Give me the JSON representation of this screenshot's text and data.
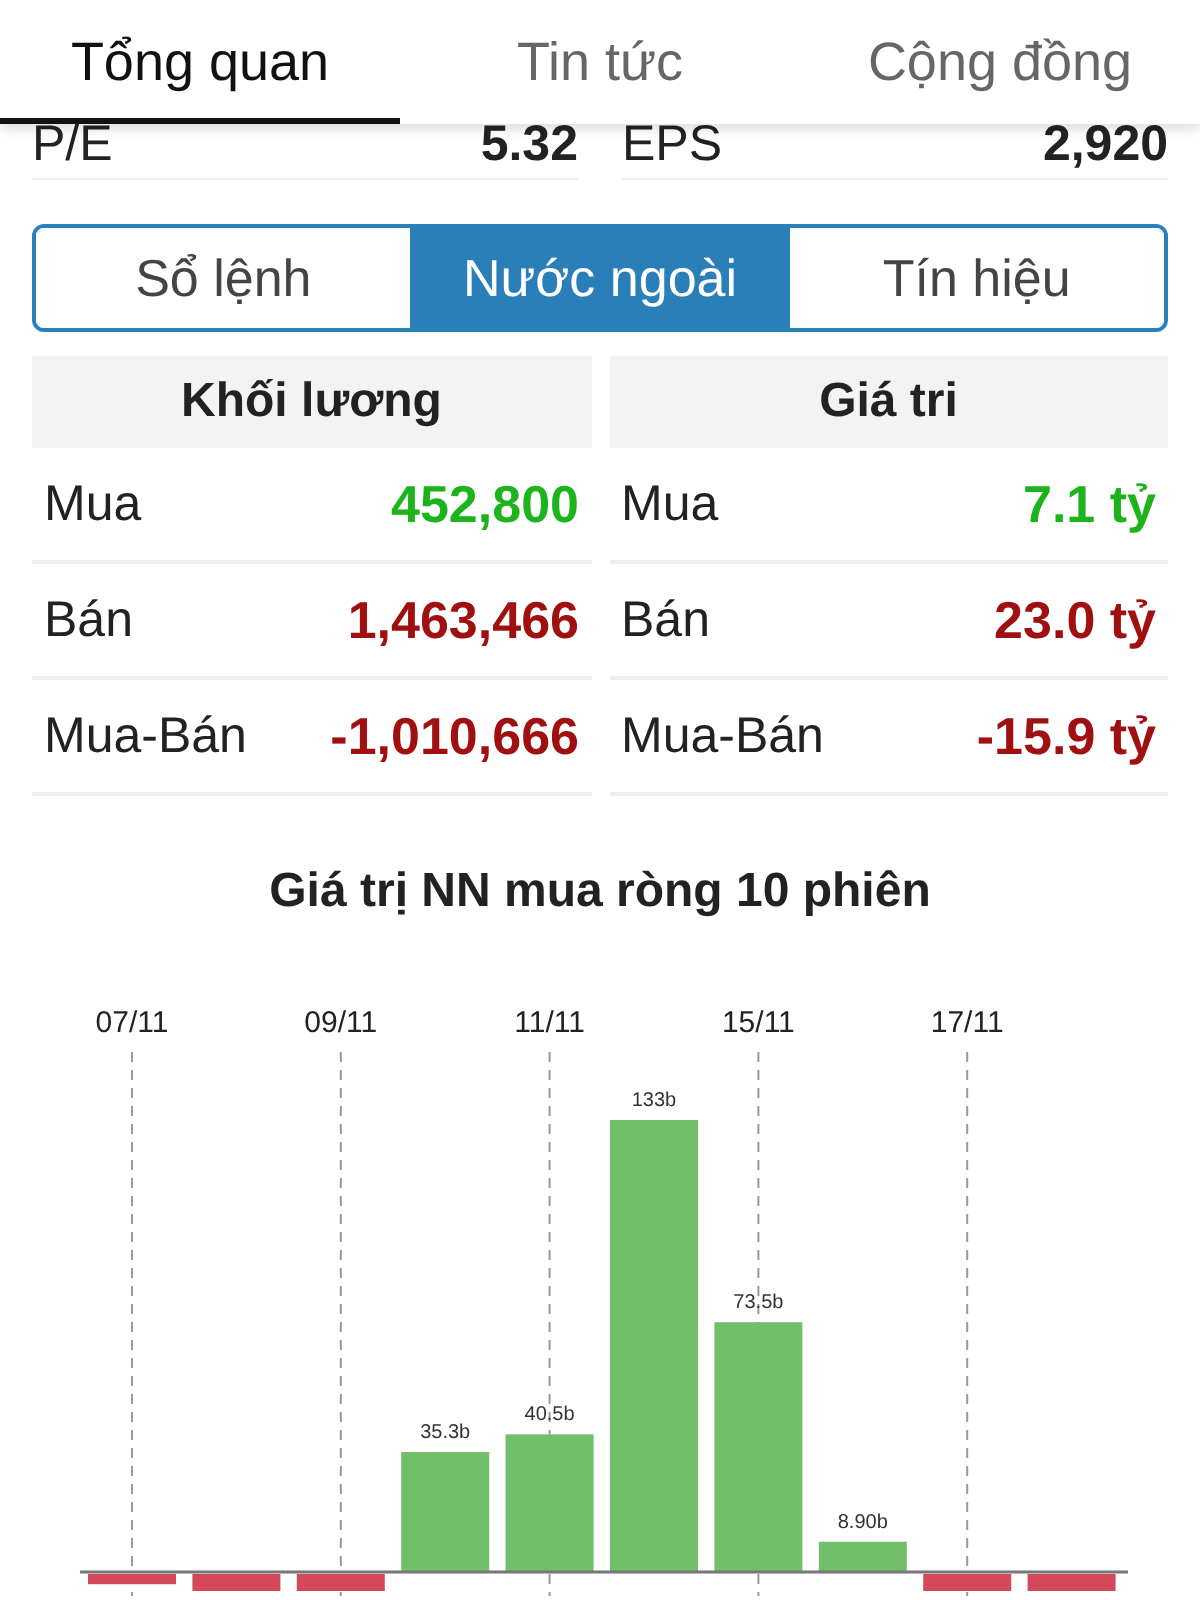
{
  "tabs": [
    {
      "label": "Tổng quan",
      "selected": true
    },
    {
      "label": "Tin tức",
      "selected": false
    },
    {
      "label": "Cộng đồng",
      "selected": false
    }
  ],
  "metrics": [
    {
      "label": "P/E",
      "value": "5.32"
    },
    {
      "label": "EPS",
      "value": "2,920"
    }
  ],
  "segments": [
    {
      "label": "Sổ lệnh",
      "selected": false
    },
    {
      "label": "Nước ngoài",
      "selected": true
    },
    {
      "label": "Tín hiệu",
      "selected": false
    }
  ],
  "tables": [
    {
      "header": "Khối lương",
      "rows": [
        {
          "label": "Mua",
          "value": "452,800",
          "color": "#1db31d"
        },
        {
          "label": "Bán",
          "value": "1,463,466",
          "color": "#a01010"
        },
        {
          "label": "Mua-Bán",
          "value": "-1,010,666",
          "color": "#a01010"
        }
      ]
    },
    {
      "header": "Giá tri",
      "rows": [
        {
          "label": "Mua",
          "value": "7.1 tỷ",
          "color": "#1db31d"
        },
        {
          "label": "Bán",
          "value": "23.0 tỷ",
          "color": "#a01010"
        },
        {
          "label": "Mua-Bán",
          "value": "-15.9 tỷ",
          "color": "#a01010"
        }
      ]
    }
  ],
  "chart": {
    "title": "Giá trị NN mua ròng 10 phiên",
    "chart_data": {
      "type": "bar",
      "categories": [
        "07/11",
        null,
        "09/11",
        null,
        "11/11",
        null,
        "15/11",
        null,
        "17/11",
        null
      ],
      "values": [
        -3,
        -5,
        -5,
        35.3,
        40.5,
        133,
        73.5,
        8.9,
        -5,
        -5
      ],
      "grid": true,
      "value_labels": [
        null,
        null,
        null,
        "35.3b",
        "40.5b",
        "133b",
        "73.5b",
        "8.90b",
        null,
        null
      ]
    }
  }
}
